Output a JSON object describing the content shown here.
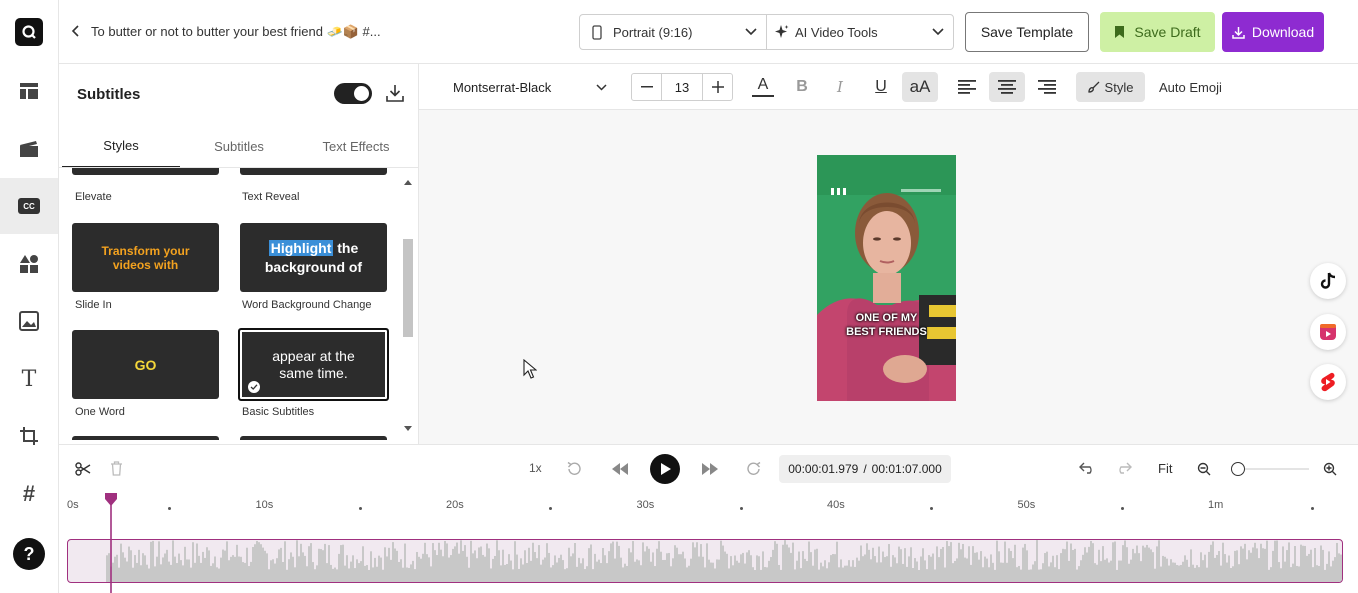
{
  "rail": {
    "logo": "app-logo",
    "items": [
      {
        "name": "layout-icon"
      },
      {
        "name": "media-icon"
      },
      {
        "name": "subtitles-icon",
        "label": "CC",
        "active": true
      },
      {
        "name": "elements-icon"
      },
      {
        "name": "images-icon"
      },
      {
        "name": "text-icon",
        "label": "T"
      },
      {
        "name": "crop-icon"
      },
      {
        "name": "hashtag-icon",
        "label": "#"
      }
    ],
    "help": "?"
  },
  "topbar": {
    "back_icon": "chevron-left-icon",
    "title": "To butter or not to butter your best friend 🧈📦 #...",
    "format": "Portrait (9:16)",
    "ai_tools": "AI Video Tools",
    "save_template": "Save Template",
    "save_draft": "Save Draft",
    "download": "Download",
    "colors": {
      "draft_bg": "#cef0a4",
      "draft_text": "#3d6b1c",
      "download_bg": "#8e2bd1"
    }
  },
  "panel": {
    "title": "Subtitles",
    "tabs": [
      "Styles",
      "Subtitles",
      "Text Effects"
    ],
    "styles": {
      "top_labels": [
        "Elevate",
        "Text Reveal"
      ],
      "cards": [
        {
          "label": "Slide In",
          "preview": "Transform your videos with"
        },
        {
          "label": "Word Background Change",
          "preview_highlight": "Highlight",
          "preview_rest1": " the",
          "preview_rest2": "background of"
        },
        {
          "label": "One Word",
          "preview": "GO"
        },
        {
          "label": "Basic Subtitles",
          "preview": "appear at the same time.",
          "selected": true
        }
      ]
    }
  },
  "format_bar": {
    "font": "Montserrat-Black",
    "font_size": "13",
    "style_label": "Style",
    "auto_emoji": "Auto Emoji",
    "case_label": "aA",
    "color_glyph": "A",
    "bold_glyph": "B",
    "italic_glyph": "I",
    "underline_glyph": "U"
  },
  "preview": {
    "caption_line1": "ONE OF MY",
    "caption_line2": "BEST FRIENDS"
  },
  "social": [
    "tiktok-icon",
    "instagram-reels-icon",
    "youtube-shorts-icon"
  ],
  "timeline": {
    "speed": "1x",
    "time_current": "00:00:01.979",
    "time_separator": "/",
    "time_total": "00:01:07.000",
    "fit": "Fit",
    "ticks": [
      "0s",
      "10s",
      "20s",
      "30s",
      "40s",
      "50s",
      "1m"
    ],
    "playhead_seconds": 1.979,
    "total_seconds": 67,
    "accent": "#a0307f"
  }
}
